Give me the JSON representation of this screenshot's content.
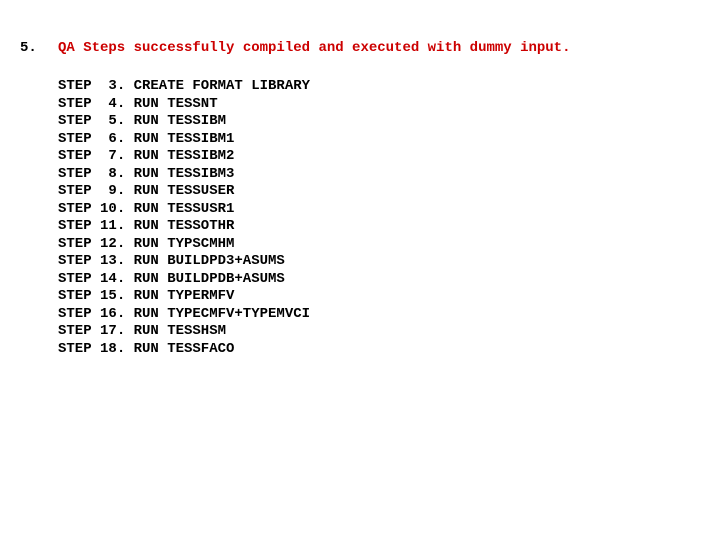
{
  "section": {
    "number": "5.",
    "title": "QA Steps successfully compiled and executed with dummy input."
  },
  "step_label": "STEP",
  "steps": [
    {
      "n": "3",
      "desc": "CREATE FORMAT LIBRARY"
    },
    {
      "n": "4",
      "desc": "RUN TESSNT"
    },
    {
      "n": "5",
      "desc": "RUN TESSIBM"
    },
    {
      "n": "6",
      "desc": "RUN TESSIBM1"
    },
    {
      "n": "7",
      "desc": "RUN TESSIBM2"
    },
    {
      "n": "8",
      "desc": "RUN TESSIBM3"
    },
    {
      "n": "9",
      "desc": "RUN TESSUSER"
    },
    {
      "n": "10",
      "desc": "RUN TESSUSR1"
    },
    {
      "n": "11",
      "desc": "RUN TESSOTHR"
    },
    {
      "n": "12",
      "desc": "RUN TYPSCMHM"
    },
    {
      "n": "13",
      "desc": "RUN BUILDPD3+ASUMS"
    },
    {
      "n": "14",
      "desc": "RUN BUILDPDB+ASUMS"
    },
    {
      "n": "15",
      "desc": "RUN TYPERMFV"
    },
    {
      "n": "16",
      "desc": "RUN TYPECMFV+TYPEMVCI"
    },
    {
      "n": "17",
      "desc": "RUN TESSHSM"
    },
    {
      "n": "18",
      "desc": "RUN TESSFACO"
    }
  ]
}
